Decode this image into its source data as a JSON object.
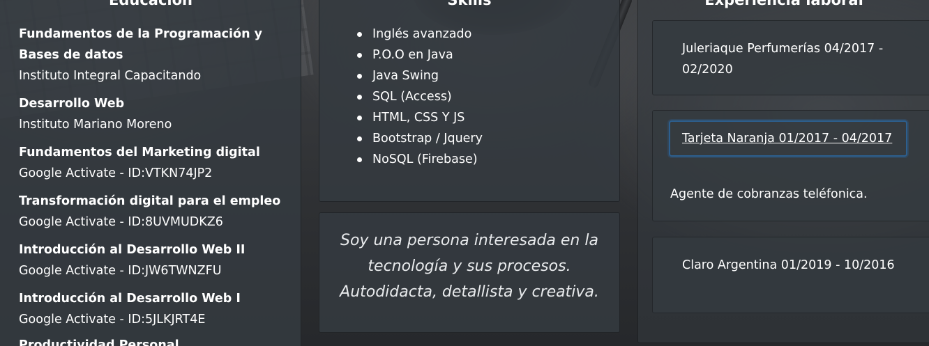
{
  "education": {
    "title": "Educación",
    "items": [
      {
        "course": "Fundamentos de la Programación y Bases de datos",
        "institution": "Instituto Integral Capacitando"
      },
      {
        "course": "Desarrollo Web",
        "institution": "Instituto Mariano Moreno"
      },
      {
        "course": "Fundamentos del Marketing digital",
        "institution": "Google Activate - ID:VTKN74JP2"
      },
      {
        "course": "Transformación digital para el empleo",
        "institution": "Google Activate - ID:8UVMUDKZ6"
      },
      {
        "course": "Introducción al Desarrollo Web II",
        "institution": "Google Activate - ID:JW6TWNZFU"
      },
      {
        "course": "Introducción al Desarrollo Web I",
        "institution": "Google Activate - ID:5JLKJRT4E"
      },
      {
        "course": "Productividad Personal",
        "institution": ""
      }
    ]
  },
  "skills": {
    "title": "Skills",
    "items": [
      "Inglés avanzado",
      "P.O.O en Java",
      "Java Swing",
      "SQL (Access)",
      "HTML, CSS Y JS",
      "Bootstrap / Jquery",
      "NoSQL (Firebase)"
    ]
  },
  "about": {
    "text": "Soy una persona interesada en la tecnología y sus procesos. Autodidacta, detallista y creativa."
  },
  "experience": {
    "title": "Experiencia laboral",
    "jobs": [
      {
        "label": "Juleriaque Perfumerías 04/2017 - 02/2020"
      },
      {
        "label": "Tarjeta Naranja 01/2017 - 04/2017",
        "description": "Agente de cobranzas teléfonica."
      },
      {
        "label": "Claro Argentina 01/2019 - 10/2016"
      }
    ]
  },
  "colors": {
    "panel": "#343a40",
    "focus_border": "#2d5f8e",
    "text": "#ffffff"
  }
}
